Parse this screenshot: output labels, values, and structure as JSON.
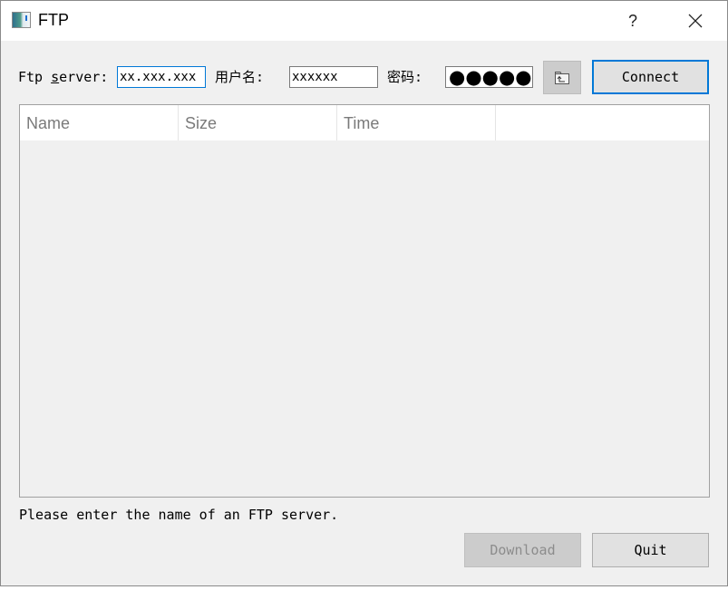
{
  "window": {
    "title": "FTP",
    "help_label": "?"
  },
  "connection": {
    "server_label_prefix": "Ftp ",
    "server_label_mnemonic": "s",
    "server_label_suffix": "erver:",
    "server_value": "xx.xxx.xxx",
    "username_label": "用户名:",
    "username_value": "xxxxxx",
    "password_label": "密码:",
    "password_value": "●●●●●",
    "cdup_icon": "folder-up-icon",
    "connect_label": "Connect"
  },
  "file_list": {
    "columns": [
      "Name",
      "Size",
      "Time",
      ""
    ],
    "rows": []
  },
  "status": {
    "text": "Please enter the name of an FTP server."
  },
  "actions": {
    "download_label": "Download",
    "download_enabled": false,
    "quit_label": "Quit"
  },
  "colors": {
    "accent": "#0078d7",
    "window_bg": "#f0f0f0",
    "disabled_text": "#8c8c8c"
  }
}
